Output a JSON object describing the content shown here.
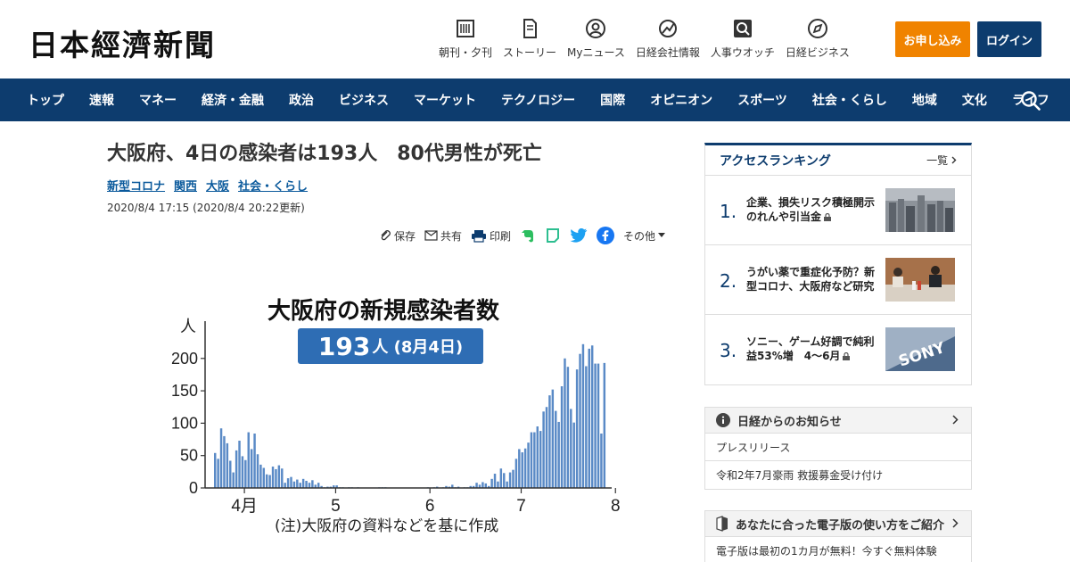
{
  "header": {
    "logo": "日本經濟新聞",
    "nav_items": [
      {
        "label": "朝刊・夕刊",
        "icon": "newspaper-icon"
      },
      {
        "label": "ストーリー",
        "icon": "document-icon"
      },
      {
        "label": "Myニュース",
        "icon": "user-icon"
      },
      {
        "label": "日経会社情報",
        "icon": "chart-up-icon"
      },
      {
        "label": "人事ウオッチ",
        "icon": "magnifier-icon"
      },
      {
        "label": "日経ビジネス",
        "icon": "compass-icon"
      }
    ],
    "apply_label": "お申し込み",
    "login_label": "ログイン",
    "colors": {
      "apply": "#f08300",
      "navy": "#0d3c6e"
    }
  },
  "navbar": {
    "items": [
      "トップ",
      "速報",
      "マネー",
      "経済・金融",
      "政治",
      "ビジネス",
      "マーケット",
      "テクノロジー",
      "国際",
      "オピニオン",
      "スポーツ",
      "社会・くらし",
      "地域",
      "文化",
      "ライフ"
    ]
  },
  "article": {
    "title": "大阪府、4日の感染者は193人　80代男性が死亡",
    "tags": [
      "新型コロナ",
      "関西",
      "大阪",
      "社会・くらし"
    ],
    "date": "2020/8/4 17:15 (2020/8/4 20:22更新)",
    "tools": {
      "save": "保存",
      "share": "共有",
      "print": "印刷",
      "more": "その他"
    }
  },
  "figure": {
    "title": "大阪府の新規感染者数",
    "badge_big": "193",
    "badge_small": "人 (8月4日)",
    "note": "(注)大阪府の資料などを基に作成"
  },
  "chart_data": {
    "type": "bar",
    "ylabel": "人",
    "ylim": [
      0,
      230
    ],
    "yticks": [
      0,
      50,
      100,
      150,
      200
    ],
    "xticks": [
      {
        "label": "4月",
        "index": 10
      },
      {
        "label": "5",
        "index": 40
      },
      {
        "label": "6",
        "index": 71
      },
      {
        "label": "7",
        "index": 101
      },
      {
        "label": "8",
        "index": 132
      }
    ],
    "values": [
      54,
      45,
      92,
      80,
      69,
      42,
      24,
      58,
      73,
      49,
      43,
      86,
      60,
      84,
      52,
      36,
      31,
      21,
      20,
      33,
      29,
      35,
      30,
      8,
      15,
      17,
      10,
      13,
      8,
      14,
      11,
      8,
      12,
      5,
      8,
      3,
      1,
      2,
      2,
      4,
      4,
      1,
      1,
      0,
      1,
      1,
      0,
      1,
      0,
      0,
      0,
      0,
      0,
      0,
      1,
      1,
      1,
      0,
      0,
      0,
      0,
      0,
      0,
      0,
      0,
      0,
      0,
      0,
      0,
      0,
      1,
      0,
      1,
      2,
      0,
      1,
      3,
      2,
      5,
      1,
      2,
      0,
      1,
      1,
      3,
      3,
      8,
      5,
      9,
      7,
      3,
      14,
      22,
      10,
      30,
      23,
      10,
      24,
      28,
      45,
      60,
      55,
      61,
      70,
      86,
      86,
      95,
      88,
      118,
      125,
      143,
      152,
      119,
      102,
      157,
      200,
      187,
      122,
      101,
      183,
      207,
      222,
      188,
      215,
      220,
      192,
      192,
      84,
      193
    ],
    "color": "#5a8ac6",
    "grid": false
  },
  "ranking": {
    "title": "アクセスランキング",
    "more": "一覧",
    "items": [
      {
        "num": "1.",
        "text": "企業、損失リスク積極開示　のれんや引当金",
        "thumb": "city-skyline-thumb"
      },
      {
        "num": "2.",
        "text": "うがい薬で重症化予防？新型コロナ、大阪府など研究",
        "thumb": "press-conference-thumb"
      },
      {
        "num": "3.",
        "text": "ソニー、ゲーム好調で純利益53%増　4～6月",
        "thumb": "sony-sign-thumb"
      }
    ]
  },
  "notices": {
    "title": "日経からのお知らせ",
    "items": [
      "プレスリリース",
      "令和2年7月豪雨 救援募金受け付け"
    ]
  },
  "guide": {
    "title": "あなたに合った電子版の使い方をご紹介",
    "line": "電子版は最初の1カ月が無料！今すぐ無料体験"
  }
}
